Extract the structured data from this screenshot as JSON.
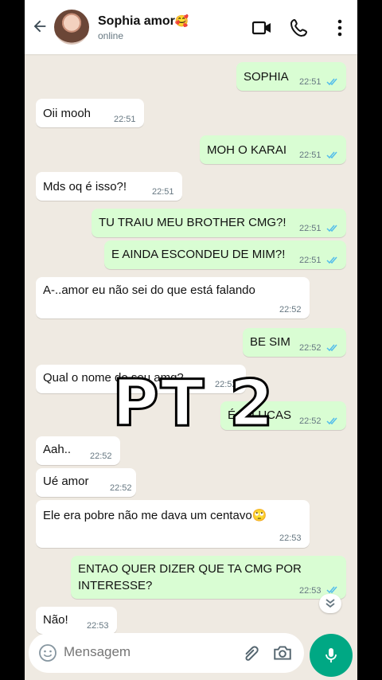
{
  "header": {
    "name": "Sophia amor",
    "name_emoji": "🥰",
    "status": "online"
  },
  "messages": [
    {
      "dir": "out",
      "text": "SOPHIA",
      "time": "22:51",
      "read": true
    },
    {
      "dir": "in",
      "text": "Oii mooh",
      "time": "22:51"
    },
    {
      "dir": "out",
      "text": "MOH O KARAI",
      "time": "22:51",
      "read": true
    },
    {
      "dir": "in",
      "text": "Mds oq é isso?!",
      "time": "22:51"
    },
    {
      "dir": "out",
      "text": "TU TRAIU MEU BROTHER CMG?!",
      "time": "22:51",
      "read": true
    },
    {
      "dir": "out",
      "text": "E AINDA ESCONDEU DE MIM?!",
      "time": "22:51",
      "read": true
    },
    {
      "dir": "in",
      "text": "A-..amor eu não sei do que está falando",
      "time": "22:52"
    },
    {
      "dir": "out",
      "text": "BE SIM",
      "time": "22:52",
      "read": true
    },
    {
      "dir": "in",
      "text": "Qual o nome do seu amg?",
      "time": "22:52"
    },
    {
      "dir": "out",
      "text": "É O LUCAS",
      "time": "22:52",
      "read": true
    },
    {
      "dir": "in",
      "text": "Aah..",
      "time": "22:52"
    },
    {
      "dir": "in",
      "text": "Ué amor",
      "time": "22:52"
    },
    {
      "dir": "in",
      "text": "Ele era pobre não me dava um centavo",
      "emoji": "🙄",
      "time": "22:53"
    },
    {
      "dir": "out",
      "text": "ENTAO QUER DIZER QUE TA CMG POR",
      "text2": "INTERESSE?",
      "time": "22:53",
      "read": true
    },
    {
      "dir": "in",
      "text": "Não!",
      "time": "22:53"
    }
  ],
  "overlay": {
    "text": "PT 2"
  },
  "composer": {
    "placeholder": "Mensagem"
  },
  "colors": {
    "outgoing": "#d9fdd3",
    "incoming": "#ffffff",
    "accent": "#00a884",
    "tick": "#53bdeb",
    "background": "#efeae2"
  }
}
